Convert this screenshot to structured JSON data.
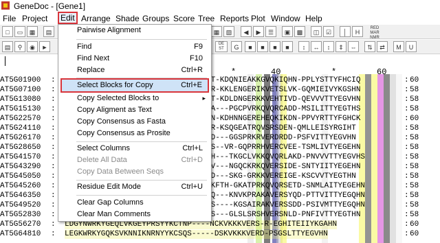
{
  "window": {
    "title": "GeneDoc - [Gene1]"
  },
  "menubar": [
    {
      "label": "File"
    },
    {
      "label": "Project"
    },
    {
      "label": "Edit"
    },
    {
      "label": "Arrange"
    },
    {
      "label": "Shade"
    },
    {
      "label": "Groups"
    },
    {
      "label": "Score"
    },
    {
      "label": "Tree"
    },
    {
      "label": "Reports"
    },
    {
      "label": "Plot"
    },
    {
      "label": "Window"
    },
    {
      "label": "Help"
    }
  ],
  "toolbar": {
    "mode_label": "RED MAR NMR",
    "dest_label": "DE ST"
  },
  "ruler": {
    "marks": [
      "*",
      "40",
      "*",
      "60"
    ]
  },
  "edit_menu": {
    "items": [
      {
        "label": "Pairwise Alignment",
        "shortcut": ""
      },
      {
        "label": "Find",
        "shortcut": "F9"
      },
      {
        "label": "Find Next",
        "shortcut": "F10"
      },
      {
        "label": "Replace",
        "shortcut": "Ctrl+R"
      },
      {
        "label": "Select Blocks for Copy",
        "shortcut": "Ctrl+E"
      },
      {
        "label": "Copy Selected Blocks to",
        "shortcut": ""
      },
      {
        "label": "Copy Aligment as Text",
        "shortcut": ""
      },
      {
        "label": "Copy Consensus as Fasta",
        "shortcut": ""
      },
      {
        "label": "Copy Consensus as Prosite",
        "shortcut": ""
      },
      {
        "label": "Select Columns",
        "shortcut": "Ctrl+L"
      },
      {
        "label": "Delete All Data",
        "shortcut": "Ctrl+D"
      },
      {
        "label": "Copy Data Between Seqs",
        "shortcut": ""
      },
      {
        "label": "Residue Edit Mode",
        "shortcut": "Ctrl+U"
      },
      {
        "label": "Clear Gap Columns",
        "shortcut": ""
      },
      {
        "label": "Clear Man Comments",
        "shortcut": ""
      }
    ]
  },
  "sequences": [
    {
      "name": "AT5G01900",
      "residues": "YT-KDQNIEAKKGVQKIQHN-PPLYSTTYFHCIQ",
      "count": "60"
    },
    {
      "name": "AT5G07100",
      "residues": "HR-KKLENGERIKVETSLVK-GQMIEIVYKGSHN",
      "count": "58"
    },
    {
      "name": "AT5G13080",
      "residues": "RT-KDLDNGERKKVEHTIVD-QEVVVTTYEGVHN",
      "count": "58"
    },
    {
      "name": "AT5G15130",
      "residues": "VA---PGCPVRKQVQRCADD-MSILITTYEGTHS",
      "count": "58"
    },
    {
      "name": "AT5G22570",
      "residues": "YN-KDHNNGEREHEQKIKDN-PPVYRTTYFGHCK",
      "count": "60"
    },
    {
      "name": "AT5G24110",
      "residues": "YR-KSQGEATRQVSRSDEN-QMLLEISYRGIHT",
      "count": "58"
    },
    {
      "name": "AT5G26170",
      "residues": "VD---GGSPRKRVERDRDD-PSFVITTYEGVHN",
      "count": "58"
    },
    {
      "name": "AT5G28650",
      "residues": "ES--VR-GQPRRHVERCVEE-TSMLIVTYEGEHN",
      "count": "58"
    },
    {
      "name": "AT5G41570",
      "residues": "YH---TKGCLVKKQVQRLAKD-PNVVVTTYEGVHS",
      "count": "58"
    },
    {
      "name": "AT5G43290",
      "residues": "VV---NGQCKRKQVERSIDE-SNTYIITYEGEHN",
      "count": "58"
    },
    {
      "name": "AT5G45050",
      "residues": "GD---SKG-GRKKVEREIGE-KSCVVTYEGTHN",
      "count": "58"
    },
    {
      "name": "AT5G45260",
      "residues": "YKFTH-GKATPRKQVQRSETD-SNMLAITYEGEHN",
      "count": "58"
    },
    {
      "name": "AT5G46350",
      "residues": "TQ---KNVKPRAKAVERSYQD-PTTVITTYEGQHN",
      "count": "58"
    },
    {
      "name": "AT5G49520",
      "residues": "TS----KGSAIRAKVERSSDD-PSIVMTTYEGQHN",
      "count": "58"
    },
    {
      "name": "AT5G52830",
      "residues": "YS---GLSLSRSHVERSNLD-PNFIVTTYEGTHN",
      "count": "58"
    },
    {
      "name": "AT5G56270",
      "residues": "LDGYNWRKYGEQLVKGEYPRSYYKCTNP----NCKVKKKVERS-R-EGHITEIIYKGAHN",
      "count": "60"
    },
    {
      "name": "AT5G64810",
      "residues": "LEGKWRKYGQKSVKNNIKNRNYYKCSQS-----DSKVKKKVERD-PSGSLTTYEGVHN",
      "count": "60"
    }
  ]
}
